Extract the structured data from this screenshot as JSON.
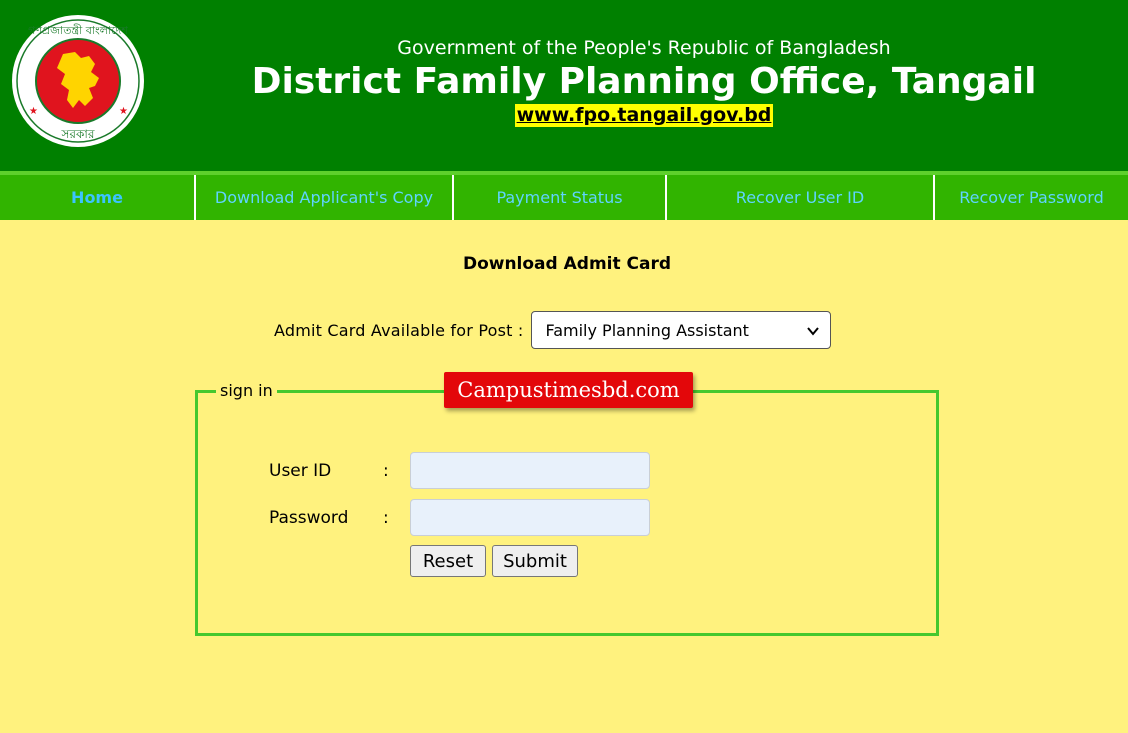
{
  "header": {
    "gov_line": "Government of the People's Republic of Bangladesh",
    "office_title": "District Family Planning Office, Tangail",
    "url": "www.fpo.tangail.gov.bd",
    "logo": {
      "icon": "bangladesh-govt-seal",
      "text_top": "গণপ্রজাতন্ত্রী বাংলাদেশ",
      "text_bottom": "সরকার"
    }
  },
  "nav": {
    "items": [
      {
        "label": "Home",
        "active": true
      },
      {
        "label": "Download Applicant's Copy"
      },
      {
        "label": "Payment Status"
      },
      {
        "label": "Recover User ID"
      },
      {
        "label": "Recover Password"
      }
    ]
  },
  "main": {
    "title": "Download Admit Card",
    "post_label": "Admit Card Available for Post :",
    "post_selected": "Family Planning Assistant"
  },
  "signin": {
    "legend": "sign in",
    "userid_label": "User ID",
    "password_label": "Password",
    "colon": ":",
    "userid_value": "",
    "password_value": "",
    "reset_label": "Reset",
    "submit_label": "Submit"
  },
  "watermark": "Campustimesbd.com",
  "colors": {
    "header": "#008000",
    "nav": "#31b400",
    "page": "#fff27e",
    "badge": "#e3070a",
    "url_bg": "#ffff00"
  }
}
